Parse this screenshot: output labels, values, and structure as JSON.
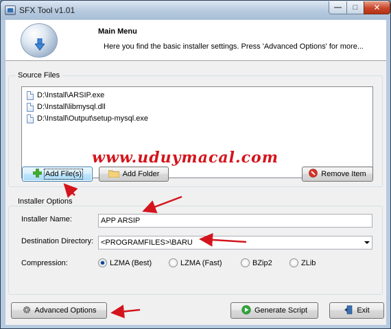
{
  "window": {
    "title": "SFX Tool v1.01",
    "min_glyph": "—",
    "max_glyph": "□",
    "close_glyph": "✕"
  },
  "header": {
    "title": "Main Menu",
    "subtitle": "Here you find the basic installer settings. Press 'Advanced Options' for more..."
  },
  "source_files": {
    "group_label": "Source Files",
    "files": [
      "D:\\Install\\ARSIP.exe",
      "D:\\Install\\libmysql.dll",
      "D:\\Install\\Output\\setup-mysql.exe"
    ],
    "add_files_label": "Add File(s)",
    "add_folder_label": "Add Folder",
    "remove_item_label": "Remove Item"
  },
  "installer_options": {
    "group_label": "Installer Options",
    "installer_name_label": "Installer Name:",
    "installer_name_value": "APP ARSIP",
    "destination_label": "Destination Directory:",
    "destination_value": "<PROGRAMFILES>\\BARU",
    "compression_label": "Compression:",
    "compression_options": [
      "LZMA (Best)",
      "LZMA (Fast)",
      "BZip2",
      "ZLib"
    ],
    "compression_selected": "LZMA (Best)"
  },
  "footer": {
    "advanced_label": "Advanced Options",
    "generate_label": "Generate Script",
    "exit_label": "Exit"
  },
  "watermark": "www.uduymacal.com",
  "colors": {
    "annotation_arrow": "#d4141c",
    "accent_blue": "#3c7fb1",
    "close_red": "#c8452a"
  }
}
